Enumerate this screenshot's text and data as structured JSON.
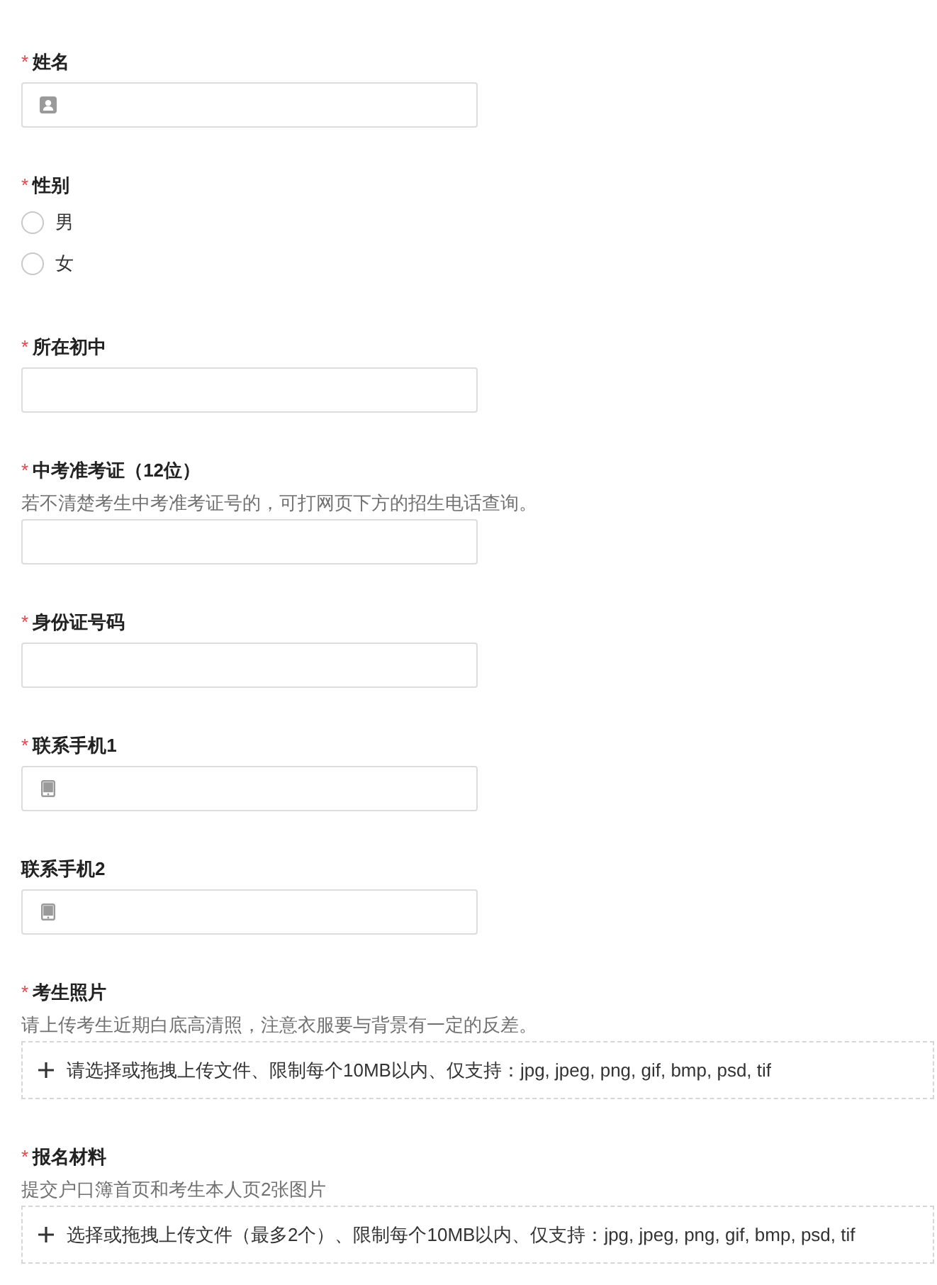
{
  "form": {
    "fields": [
      {
        "kind": "name_input",
        "required_mark": "*",
        "label": "姓名"
      },
      {
        "kind": "radio",
        "required_mark": "*",
        "label": "性别",
        "options": [
          {
            "label": "男",
            "selected": false
          },
          {
            "label": "女",
            "selected": false
          }
        ]
      },
      {
        "kind": "text_input",
        "required_mark": "*",
        "label": "所在初中"
      },
      {
        "kind": "text_input",
        "required_mark": "*",
        "label": "中考准考证（12位）",
        "hint": "若不清楚考生中考准考证号的，可打网页下方的招生电话查询。"
      },
      {
        "kind": "text_input",
        "required_mark": "*",
        "label": "身份证号码"
      },
      {
        "kind": "phone_input",
        "required_mark": "*",
        "label": "联系手机1"
      },
      {
        "kind": "phone_input",
        "label": "联系手机2"
      },
      {
        "kind": "upload",
        "required_mark": "*",
        "label": "考生照片",
        "hint": "请上传考生近期白底高清照，注意衣服要与背景有一定的反差。",
        "upload_text": "请选择或拖拽上传文件、限制每个10MB以内、仅支持：jpg, jpeg, png, gif, bmp, psd, tif"
      },
      {
        "kind": "upload",
        "required_mark": "*",
        "label": "报名材料",
        "hint": "提交户口簿首页和考生本人页2张图片",
        "upload_text": "选择或拖拽上传文件（最多2个）、限制每个10MB以内、仅支持：jpg, jpeg, png, gif, bmp, psd, tif"
      }
    ]
  }
}
